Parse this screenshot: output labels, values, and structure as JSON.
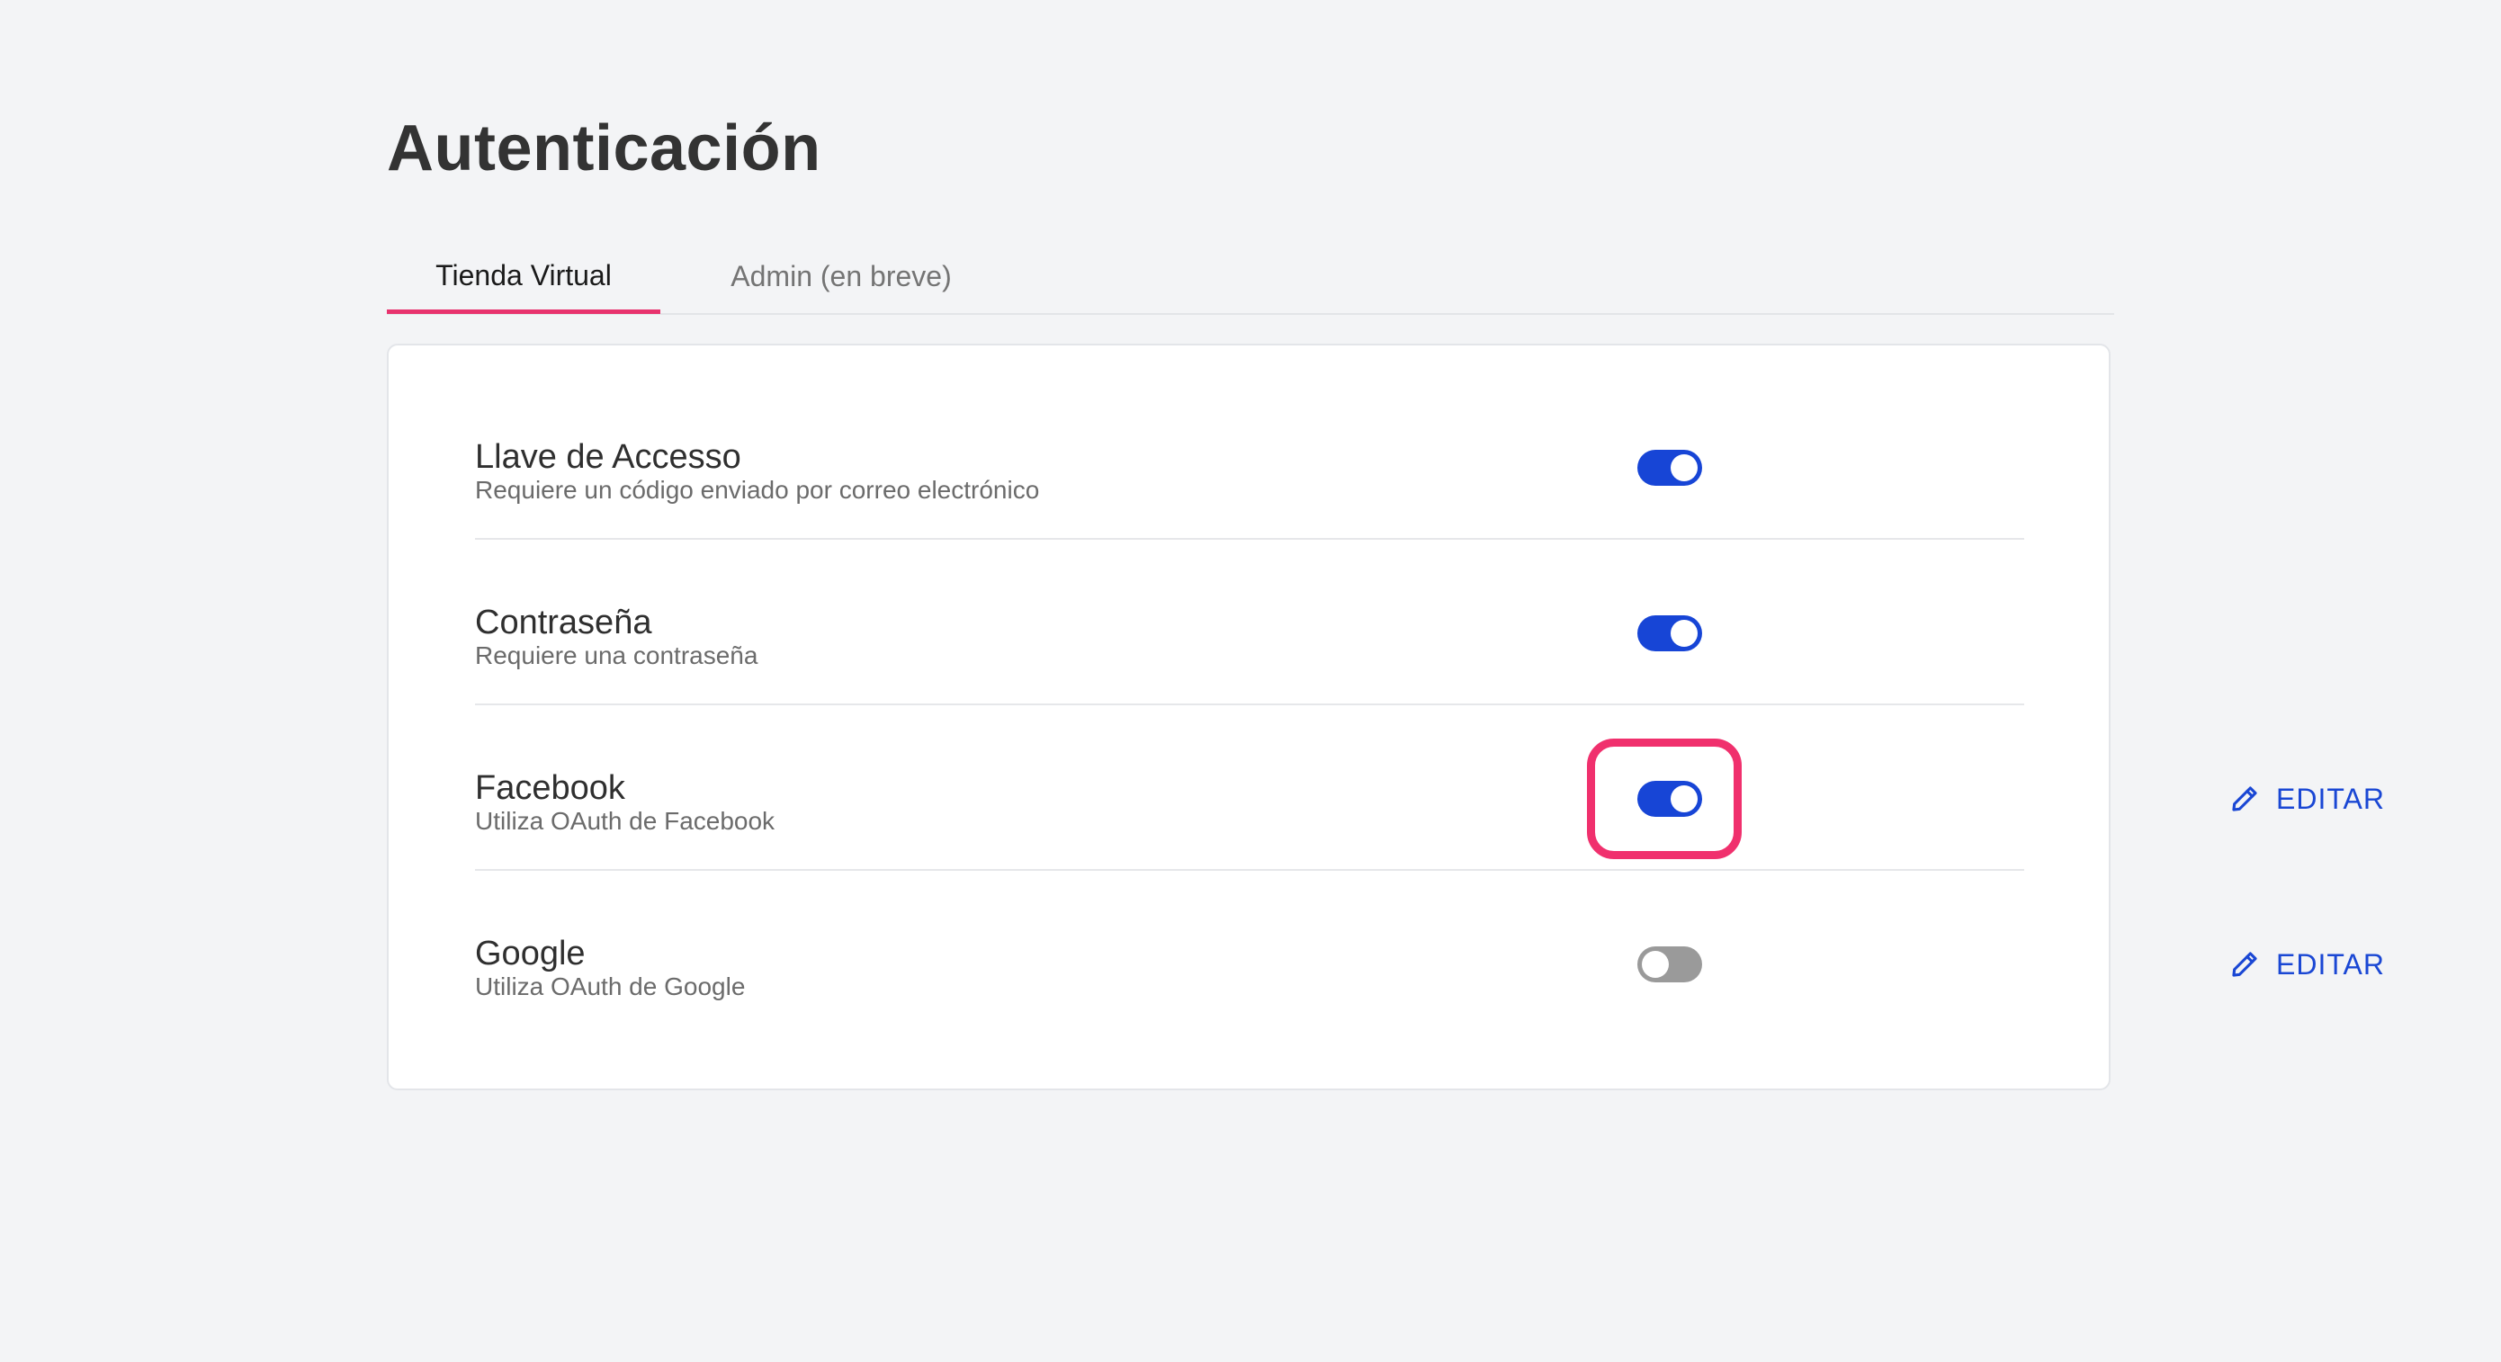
{
  "page": {
    "title": "Autenticación"
  },
  "tabs": [
    {
      "label": "Tienda Virtual",
      "active": true
    },
    {
      "label": "Admin (en breve)",
      "active": false
    }
  ],
  "methods": [
    {
      "title": "Llave de Accesso",
      "description": "Requiere un código enviado por correo electrónico",
      "enabled": true
    },
    {
      "title": "Contraseña",
      "description": "Requiere una contraseña",
      "enabled": true
    },
    {
      "title": "Facebook",
      "description": "Utiliza OAuth de Facebook",
      "enabled": true,
      "edit_label": "EDITAR",
      "highlighted": true
    },
    {
      "title": "Google",
      "description": "Utiliza OAuth de Google",
      "enabled": false,
      "edit_label": "EDITAR"
    }
  ],
  "colors": {
    "accent": "#1745d6",
    "tab_underline": "#e8336e",
    "highlight": "#f0306d",
    "background": "#f3f4f6"
  },
  "icons": {
    "edit": "pencil-icon"
  }
}
